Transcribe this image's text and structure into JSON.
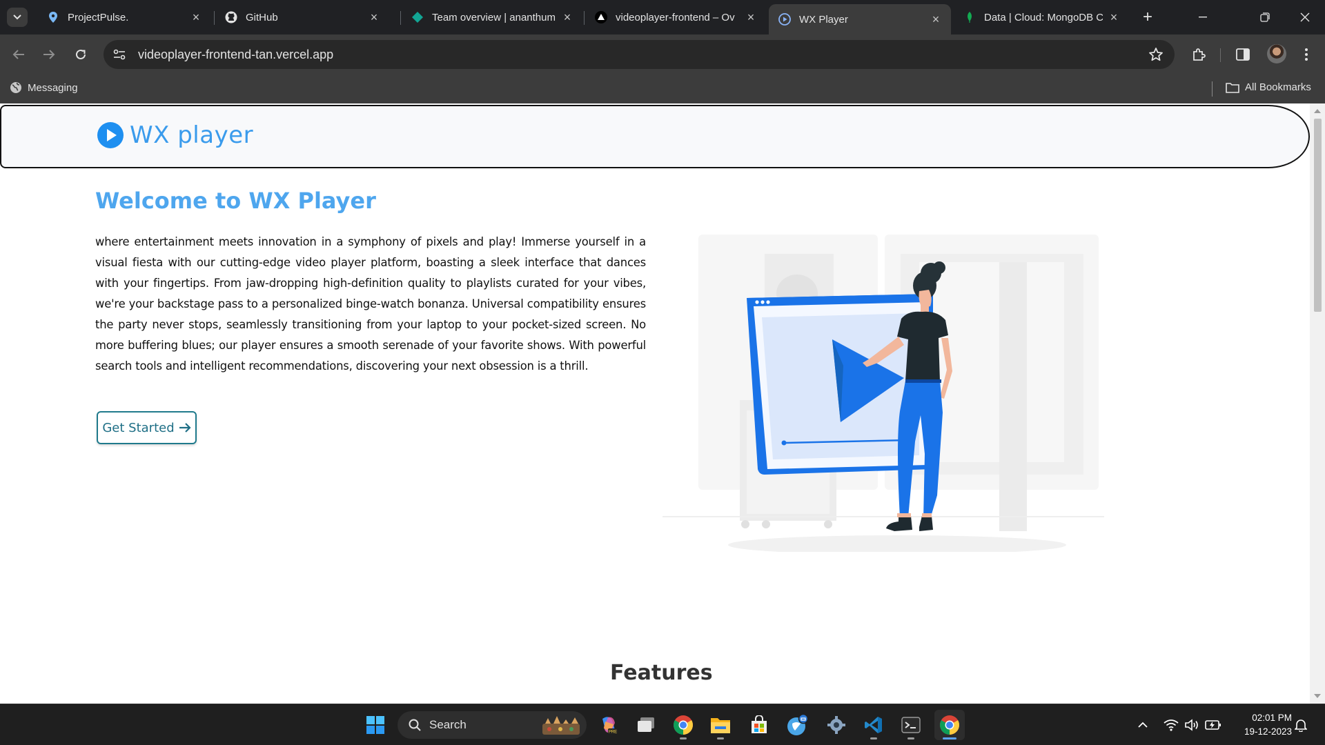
{
  "browser": {
    "tabs": [
      {
        "title": "ProjectPulse.",
        "icon": "location-pin-icon"
      },
      {
        "title": "GitHub",
        "icon": "github-icon"
      },
      {
        "title": "Team overview | ananthum",
        "icon": "diamond-icon"
      },
      {
        "title": "videoplayer-frontend – Ov",
        "icon": "vercel-triangle-icon"
      },
      {
        "title": "WX Player",
        "icon": "play-circle-icon",
        "active": true
      },
      {
        "title": "Data | Cloud: MongoDB Cl",
        "icon": "mongodb-leaf-icon"
      }
    ],
    "url": "videoplayer-frontend-tan.vercel.app",
    "bookmarks": {
      "messaging": "Messaging",
      "all_bookmarks": "All Bookmarks"
    }
  },
  "page": {
    "brand": "WX player",
    "hero_title": "Welcome to WX Player",
    "hero_text": "where entertainment meets innovation in a symphony of pixels and play! Immerse yourself in a visual fiesta with our cutting-edge video player platform, boasting a sleek interface that dances with your fingertips. From jaw-dropping high-definition quality to playlists curated for your vibes, we're your backstage pass to a personalized binge-watch bonanza. Universal compatibility ensures the party never stops, seamlessly transitioning from your laptop to your pocket-sized screen. No more buffering blues; our player ensures a smooth serenade of your favorite shows. With powerful search tools and intelligent recommendations, discovering your next obsession is a thrill.",
    "cta_label": "Get Started",
    "features_title": "Features"
  },
  "taskbar": {
    "search_label": "Search",
    "time": "02:01 PM",
    "date": "19-12-2023"
  },
  "colors": {
    "brand_blue": "#3a9bec",
    "cta_teal": "#1f6f86",
    "illustration_blue": "#1a73e8"
  }
}
